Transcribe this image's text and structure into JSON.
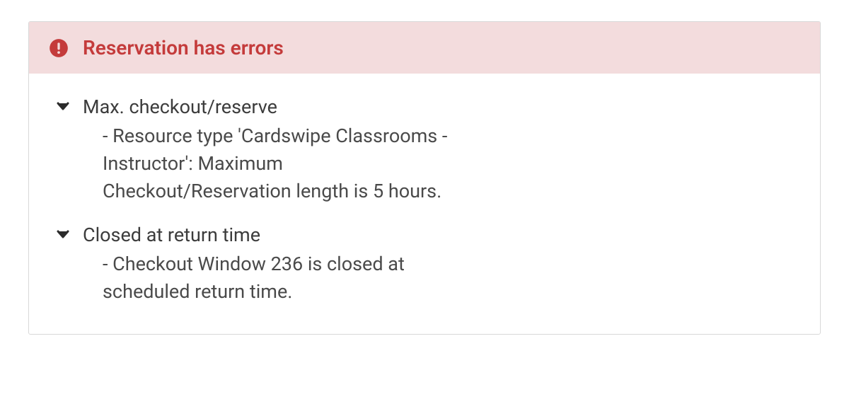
{
  "colors": {
    "error_accent": "#c43b3b",
    "error_bg": "#f3dcdd",
    "text_dark": "#3c3c3c",
    "text_body": "#4a4a4a",
    "border": "#d8d8d8"
  },
  "alert": {
    "icon": "error-circle-icon",
    "title": "Reservation has errors",
    "items": [
      {
        "title": "Max. checkout/reserve",
        "detail": "- Resource type 'Cardswipe Classrooms - Instructor': Maximum Checkout/Reservation length is 5 hours."
      },
      {
        "title": "Closed at return time",
        "detail": "- Checkout Window 236 is closed at scheduled return time."
      }
    ]
  }
}
